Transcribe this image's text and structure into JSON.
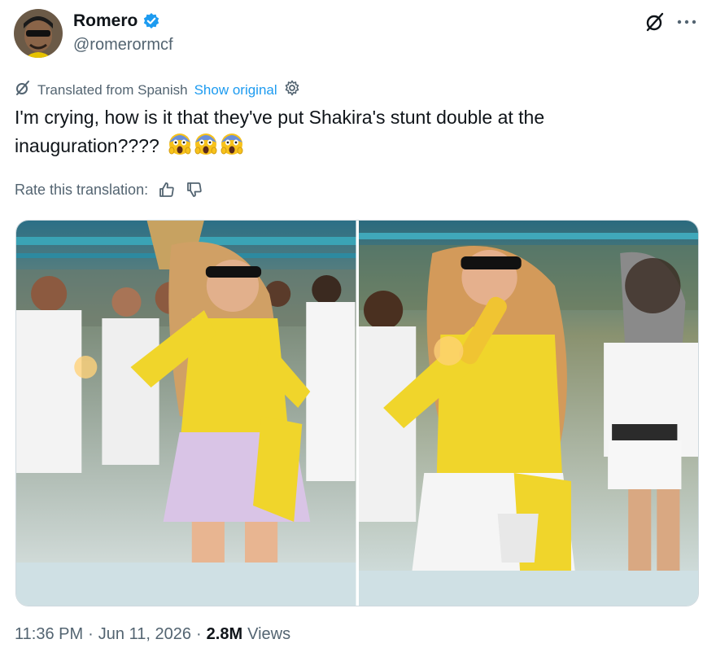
{
  "author": {
    "name": "Romero",
    "handle": "@romerormcf"
  },
  "translation": {
    "notice": "Translated from Spanish",
    "show_original": "Show original"
  },
  "tweet": {
    "text": "I'm crying, how is it that they've put Shakira's stunt double at the inauguration????",
    "emoji_count": 3
  },
  "rate": {
    "label": "Rate this translation:"
  },
  "meta": {
    "time": "11:36 PM",
    "separator": "·",
    "date": "Jun 11, 2026",
    "views_count": "2.8M",
    "views_label": "Views"
  },
  "colors": {
    "accent": "#1d9bf0",
    "secondary_text": "#536471"
  }
}
